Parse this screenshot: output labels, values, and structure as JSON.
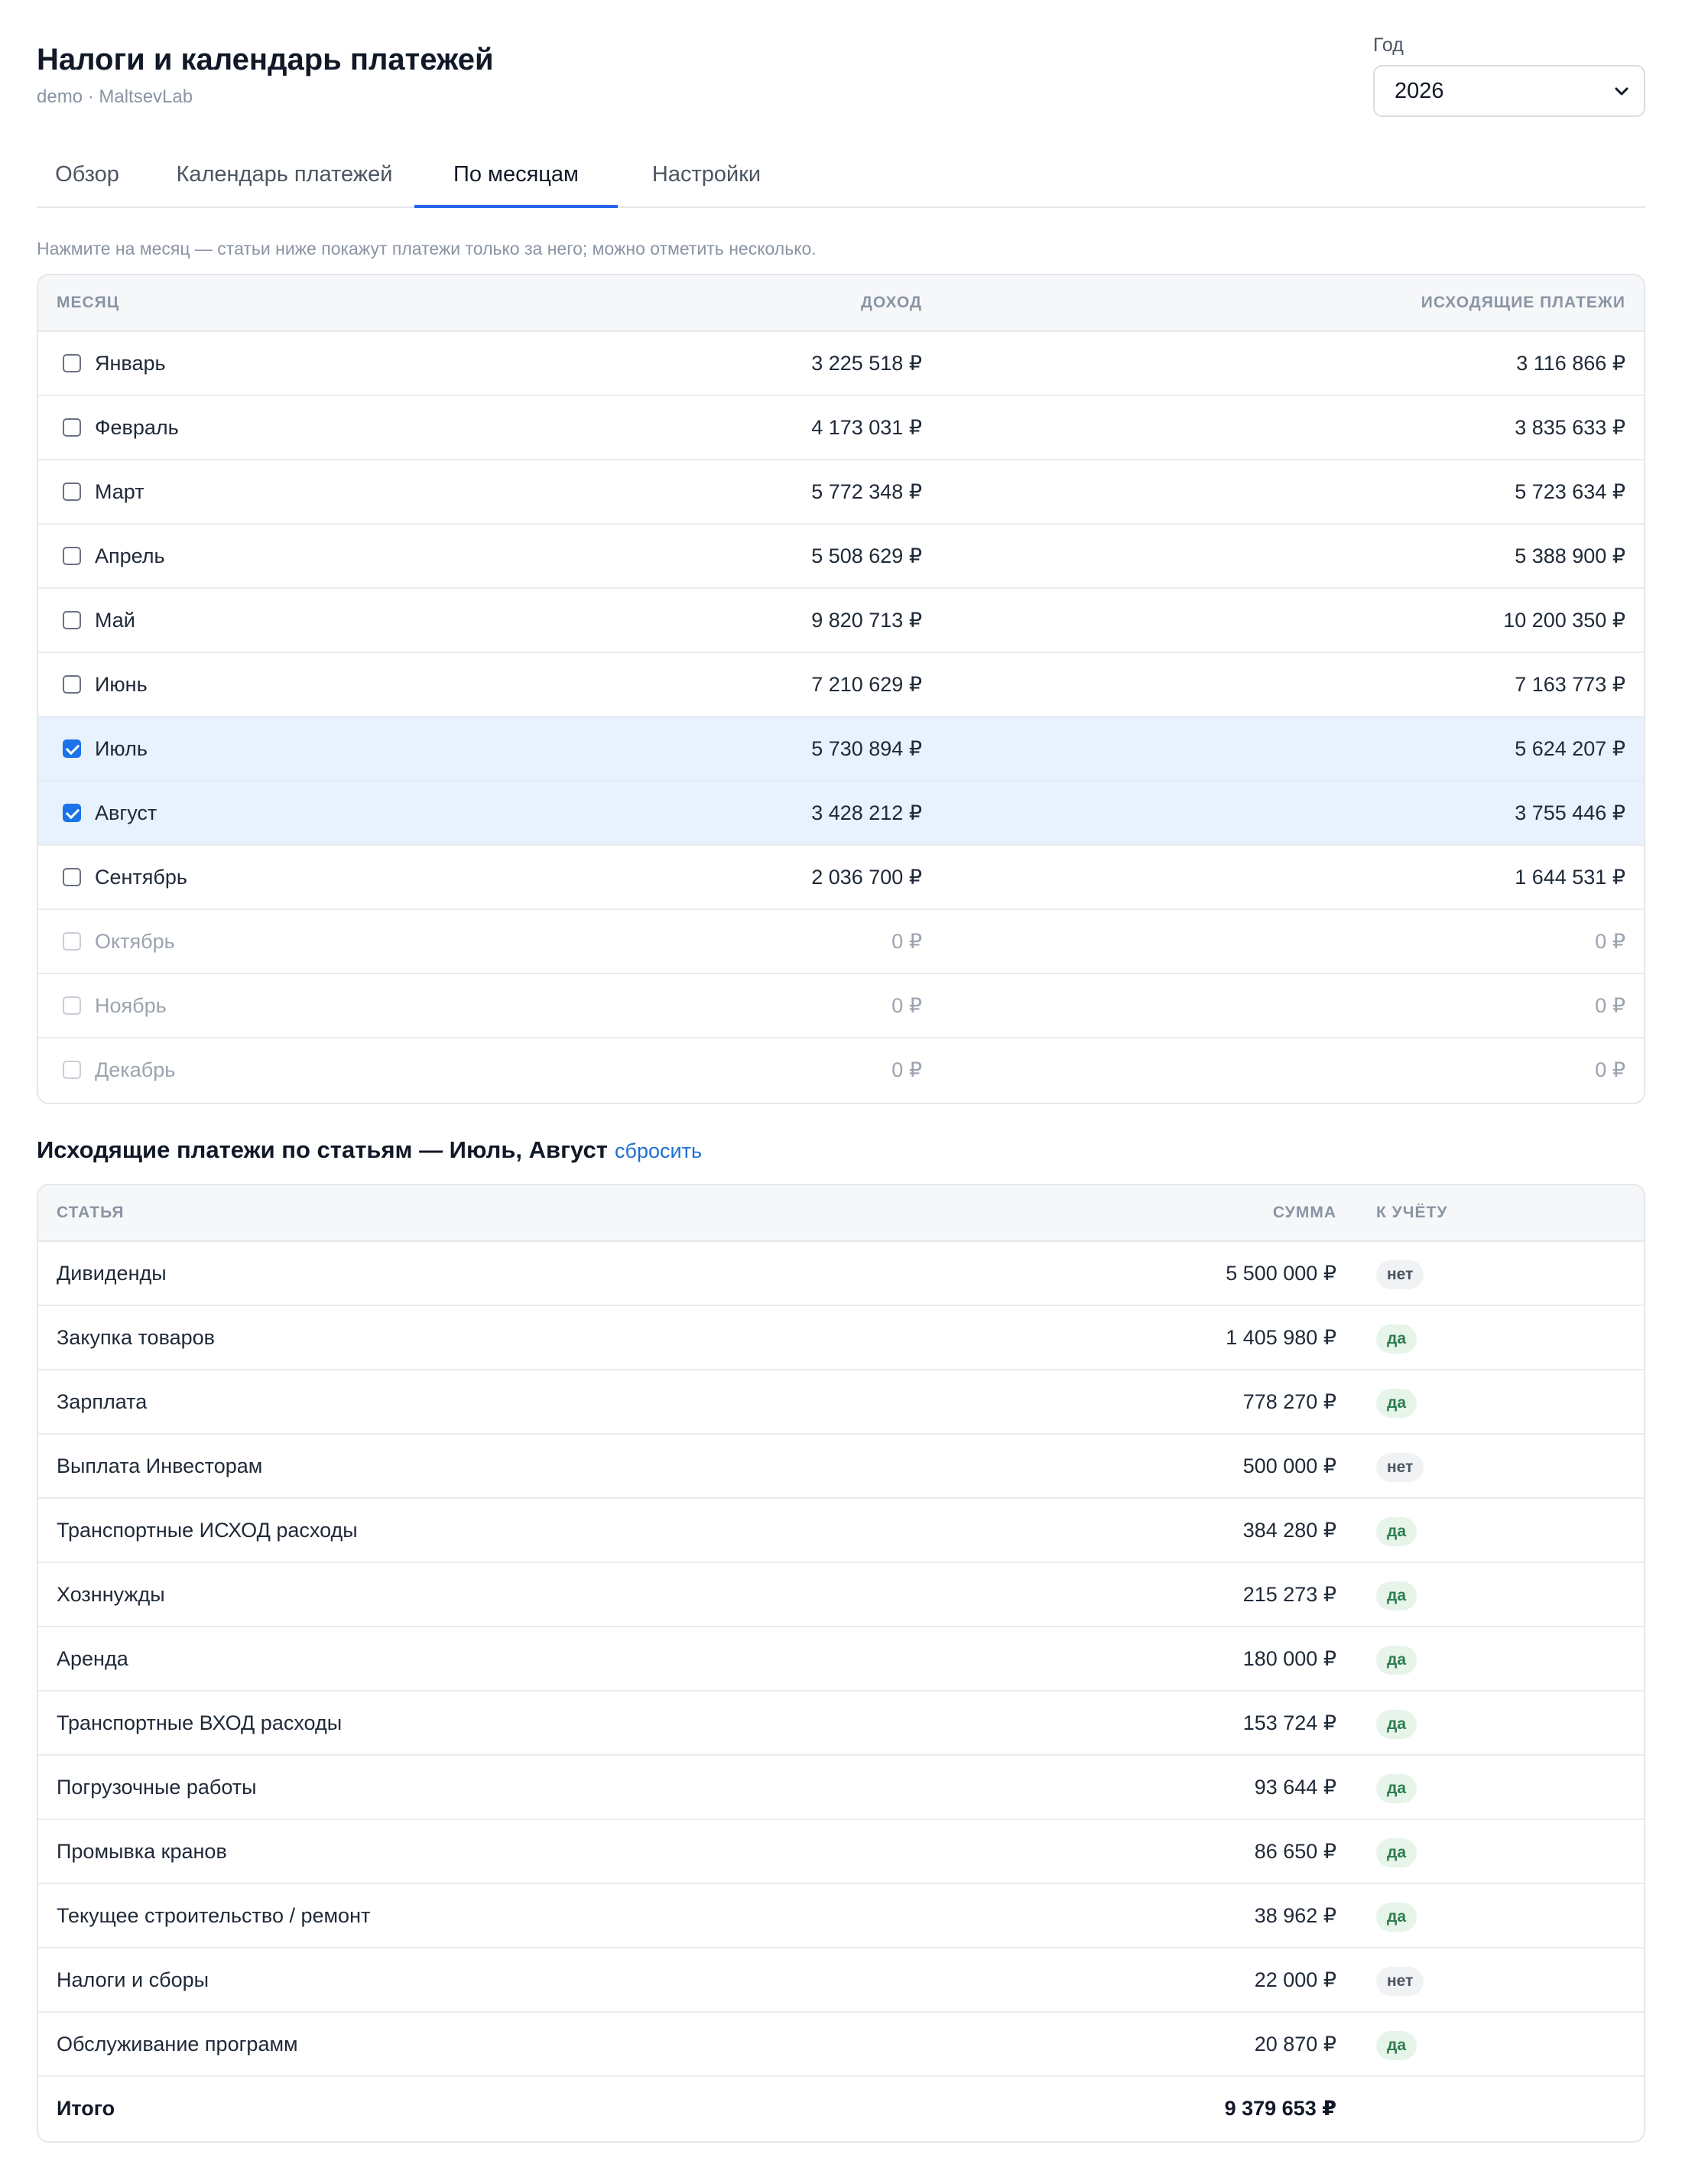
{
  "header": {
    "title": "Налоги и календарь платежей",
    "subtitle": "demo · MaltsevLab",
    "year_label": "Год",
    "year_value": "2026"
  },
  "tabs": [
    {
      "label": "Обзор",
      "active": false
    },
    {
      "label": "Календарь платежей",
      "active": false
    },
    {
      "label": "По месяцам",
      "active": true
    },
    {
      "label": "Настройки",
      "active": false
    }
  ],
  "hint": "Нажмите на месяц — статьи ниже покажут платежи только за него; можно отметить несколько.",
  "months_table": {
    "headers": {
      "month": "Месяц",
      "income": "Доход",
      "outgoing": "Исходящие платежи"
    },
    "rows": [
      {
        "month": "Январь",
        "income": "3 225 518 ₽",
        "outgoing": "3 116 866 ₽",
        "checked": false,
        "disabled": false
      },
      {
        "month": "Февраль",
        "income": "4 173 031 ₽",
        "outgoing": "3 835 633 ₽",
        "checked": false,
        "disabled": false
      },
      {
        "month": "Март",
        "income": "5 772 348 ₽",
        "outgoing": "5 723 634 ₽",
        "checked": false,
        "disabled": false
      },
      {
        "month": "Апрель",
        "income": "5 508 629 ₽",
        "outgoing": "5 388 900 ₽",
        "checked": false,
        "disabled": false
      },
      {
        "month": "Май",
        "income": "9 820 713 ₽",
        "outgoing": "10 200 350 ₽",
        "checked": false,
        "disabled": false
      },
      {
        "month": "Июнь",
        "income": "7 210 629 ₽",
        "outgoing": "7 163 773 ₽",
        "checked": false,
        "disabled": false
      },
      {
        "month": "Июль",
        "income": "5 730 894 ₽",
        "outgoing": "5 624 207 ₽",
        "checked": true,
        "disabled": false
      },
      {
        "month": "Август",
        "income": "3 428 212 ₽",
        "outgoing": "3 755 446 ₽",
        "checked": true,
        "disabled": false
      },
      {
        "month": "Сентябрь",
        "income": "2 036 700 ₽",
        "outgoing": "1 644 531 ₽",
        "checked": false,
        "disabled": false
      },
      {
        "month": "Октябрь",
        "income": "0 ₽",
        "outgoing": "0 ₽",
        "checked": false,
        "disabled": true
      },
      {
        "month": "Ноябрь",
        "income": "0 ₽",
        "outgoing": "0 ₽",
        "checked": false,
        "disabled": true
      },
      {
        "month": "Декабрь",
        "income": "0 ₽",
        "outgoing": "0 ₽",
        "checked": false,
        "disabled": true
      }
    ]
  },
  "articles_section": {
    "title": "Исходящие платежи по статьям — Июль, Август",
    "reset_label": "сбросить"
  },
  "articles_table": {
    "headers": {
      "article": "Статья",
      "amount": "Сумма",
      "counted": "К учёту"
    },
    "rows": [
      {
        "article": "Дивиденды",
        "amount": "5 500 000 ₽",
        "counted": "нет"
      },
      {
        "article": "Закупка товаров",
        "amount": "1 405 980 ₽",
        "counted": "да"
      },
      {
        "article": "Зарплата",
        "amount": "778 270 ₽",
        "counted": "да"
      },
      {
        "article": "Выплата Инвесторам",
        "amount": "500 000 ₽",
        "counted": "нет"
      },
      {
        "article": "Транспортные ИСХОД расходы",
        "amount": "384 280 ₽",
        "counted": "да"
      },
      {
        "article": "Хозннужды",
        "amount": "215 273 ₽",
        "counted": "да"
      },
      {
        "article": "Аренда",
        "amount": "180 000 ₽",
        "counted": "да"
      },
      {
        "article": "Транспортные ВХОД расходы",
        "amount": "153 724 ₽",
        "counted": "да"
      },
      {
        "article": "Погрузочные работы",
        "amount": "93 644 ₽",
        "counted": "да"
      },
      {
        "article": "Промывка кранов",
        "amount": "86 650 ₽",
        "counted": "да"
      },
      {
        "article": "Текущее строительство / ремонт",
        "amount": "38 962 ₽",
        "counted": "да"
      },
      {
        "article": "Налоги и сборы",
        "amount": "22 000 ₽",
        "counted": "нет"
      },
      {
        "article": "Обслуживание программ",
        "amount": "20 870 ₽",
        "counted": "да"
      }
    ],
    "total": {
      "label": "Итого",
      "amount": "9 379 653 ₽"
    }
  }
}
